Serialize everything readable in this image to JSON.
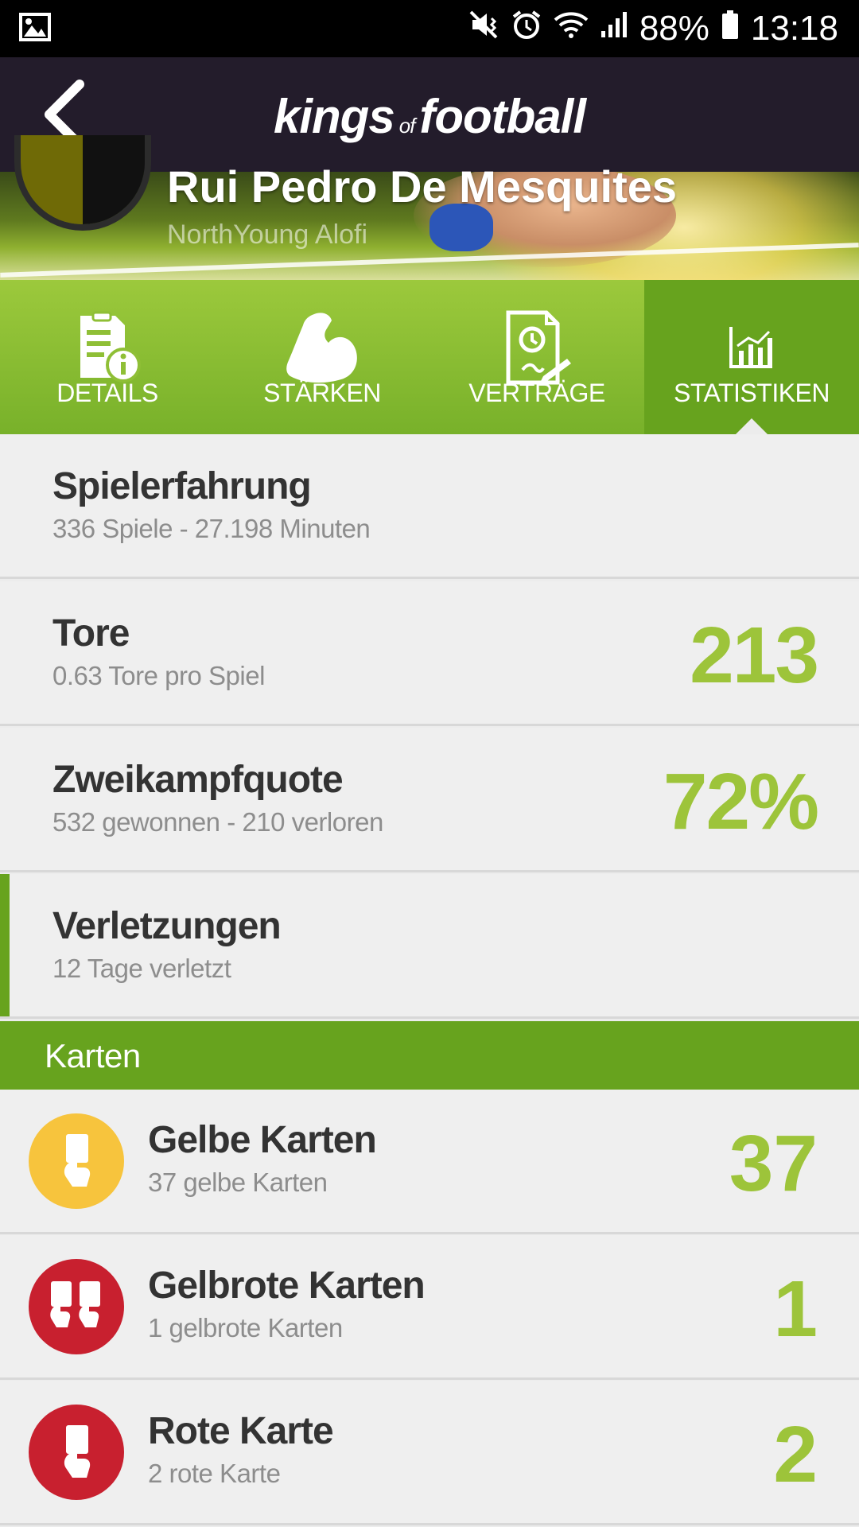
{
  "status_bar": {
    "battery": "88%",
    "time": "13:18",
    "icons": [
      "gallery-icon",
      "mute-vibrate-icon",
      "alarm-icon",
      "wifi-icon",
      "signal-icon",
      "battery-icon"
    ]
  },
  "header": {
    "logo_kings": "kings",
    "logo_of": "of",
    "logo_football": "football"
  },
  "player": {
    "name": "Rui Pedro De Mesquites",
    "team": "NorthYoung Alofi"
  },
  "tabs": [
    {
      "label": "DETAILS",
      "icon": "document-info-icon"
    },
    {
      "label": "STÄRKEN",
      "icon": "flexed-bicep-icon"
    },
    {
      "label": "VERTRÄGE",
      "icon": "contract-icon"
    },
    {
      "label": "STATISTIKEN",
      "icon": "bar-chart-icon",
      "active": true
    }
  ],
  "stats": [
    {
      "title": "Spielerfahrung",
      "sub": "336 Spiele - 27.198 Minuten",
      "value": ""
    },
    {
      "title": "Tore",
      "sub": "0.63 Tore pro Spiel",
      "value": "213"
    },
    {
      "title": "Zweikampfquote",
      "sub": "532 gewonnen - 210 verloren",
      "value": "72%"
    },
    {
      "title": "Verletzungen",
      "sub": "12 Tage verletzt",
      "value": ""
    }
  ],
  "cards_section": {
    "title": "Karten",
    "items": [
      {
        "title": "Gelbe Karten",
        "sub": "37 gelbe Karten",
        "value": "37",
        "icon": "yellow-card-icon",
        "color": "#f7c43d"
      },
      {
        "title": "Gelbrote Karten",
        "sub": "1 gelbrote Karten",
        "value": "1",
        "icon": "yellow-red-card-icon",
        "color": "#c8202f"
      },
      {
        "title": "Rote Karte",
        "sub": "2 rote Karte",
        "value": "2",
        "icon": "red-card-icon",
        "color": "#c8202f"
      }
    ]
  },
  "colors": {
    "accent_green": "#67a31e",
    "value_green": "#9dc43a",
    "header_dark": "#231c2b"
  }
}
